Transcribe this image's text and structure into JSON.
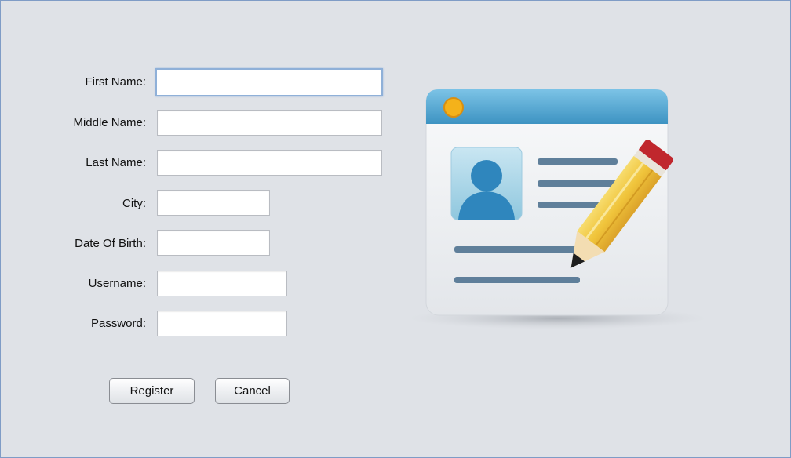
{
  "form": {
    "fields": [
      {
        "label": "First Name:",
        "value": ""
      },
      {
        "label": "Middle Name:",
        "value": ""
      },
      {
        "label": "Last Name:",
        "value": ""
      },
      {
        "label": "City:",
        "value": ""
      },
      {
        "label": "Date Of Birth:",
        "value": ""
      },
      {
        "label": "Username:",
        "value": ""
      },
      {
        "label": "Password:",
        "value": ""
      }
    ],
    "focused_field": "First Name:"
  },
  "buttons": {
    "register_label": "Register",
    "cancel_label": "Cancel"
  },
  "illustration": {
    "icon": "user-profile-card-with-pencil-icon",
    "colors": {
      "header": "#4aa3cf",
      "dot": "#f4b21a",
      "avatar": "#2f86bd",
      "lines": "#5f7f9a",
      "pencil_body": "#f0c43b",
      "pencil_eraser": "#c0272d"
    }
  }
}
